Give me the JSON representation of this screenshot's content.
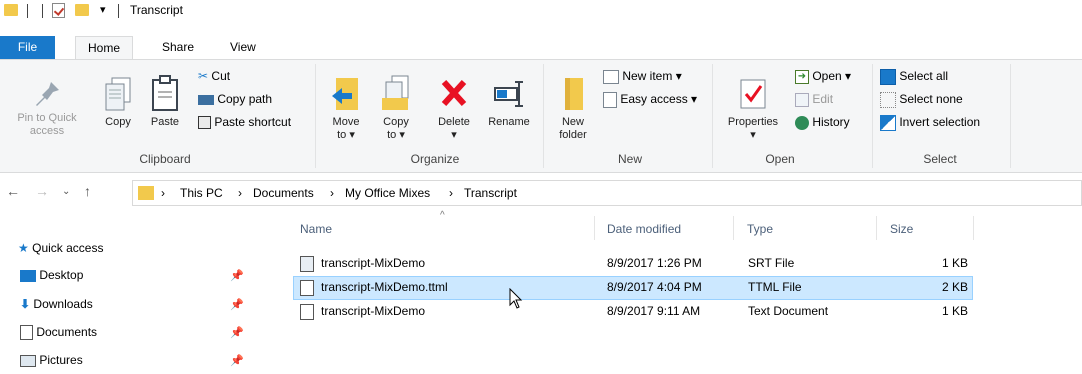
{
  "window": {
    "title": "Transcript"
  },
  "ribbon_tabs": [
    {
      "label": "File"
    },
    {
      "label": "Home"
    },
    {
      "label": "Share"
    },
    {
      "label": "View"
    }
  ],
  "ribbon": {
    "clipboard": {
      "group_label": "Clipboard",
      "pin_label_1": "Pin to Quick",
      "pin_label_2": "access",
      "copy_label": "Copy",
      "paste_label": "Paste",
      "cut_label": "Cut",
      "copy_path_label": "Copy path",
      "paste_shortcut_label": "Paste shortcut"
    },
    "organize": {
      "group_label": "Organize",
      "move_to_label_1": "Move",
      "move_to_label_2": "to ▾",
      "copy_to_label_1": "Copy",
      "copy_to_label_2": "to ▾",
      "delete_label_1": "Delete",
      "delete_label_2": "▾",
      "rename_label": "Rename"
    },
    "new": {
      "group_label": "New",
      "new_folder_label_1": "New",
      "new_folder_label_2": "folder",
      "new_item_label": "New item ▾",
      "easy_access_label": "Easy access ▾"
    },
    "open": {
      "group_label": "Open",
      "properties_label_1": "Properties",
      "properties_label_2": "▾",
      "open_label": "Open ▾",
      "edit_label": "Edit",
      "history_label": "History"
    },
    "select": {
      "group_label": "Select",
      "select_all_label": "Select all",
      "select_none_label": "Select none",
      "invert_selection_label": "Invert selection"
    }
  },
  "address_bar": {
    "crumbs": [
      {
        "label": "This PC"
      },
      {
        "label": "Documents"
      },
      {
        "label": "My Office Mixes"
      },
      {
        "label": "Transcript"
      }
    ],
    "separator": "›"
  },
  "navigation_pane": {
    "items": [
      {
        "label": "Quick access"
      },
      {
        "label": "Desktop"
      },
      {
        "label": "Downloads"
      },
      {
        "label": "Documents"
      },
      {
        "label": "Pictures"
      }
    ]
  },
  "file_list": {
    "columns": [
      {
        "label": "Name"
      },
      {
        "label": "Date modified"
      },
      {
        "label": "Type"
      },
      {
        "label": "Size"
      }
    ],
    "rows": [
      {
        "name": "transcript-MixDemo",
        "date": "8/9/2017 1:26 PM",
        "type": "SRT File",
        "size": "1 KB"
      },
      {
        "name": "transcript-MixDemo.ttml",
        "date": "8/9/2017 4:04 PM",
        "type": "TTML File",
        "size": "2 KB"
      },
      {
        "name": "transcript-MixDemo",
        "date": "8/9/2017 9:11 AM",
        "type": "Text Document",
        "size": "1 KB"
      }
    ]
  },
  "colors": {
    "file_tab": "#1979ca",
    "selected_row": "#cce8ff",
    "folder": "#f2c94c",
    "delete": "#e81123"
  }
}
